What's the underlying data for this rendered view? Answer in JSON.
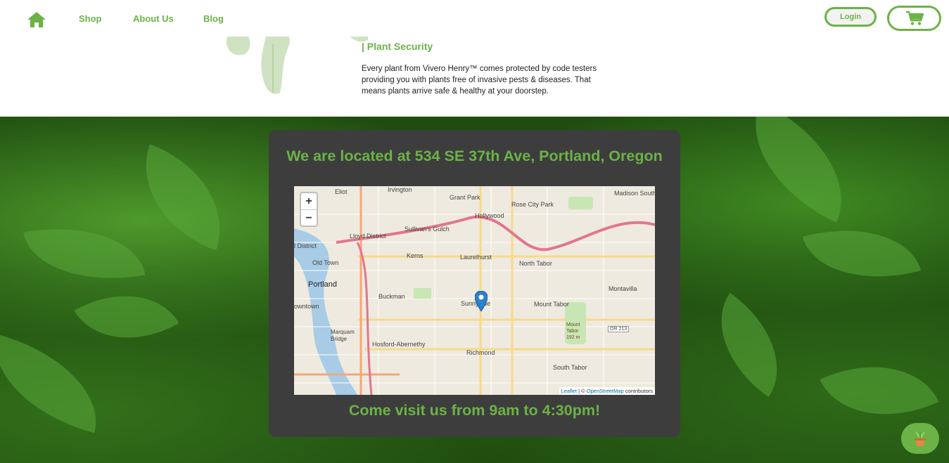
{
  "nav": {
    "links": [
      "Shop",
      "About Us",
      "Blog"
    ],
    "login_label": "Login"
  },
  "security": {
    "title": "| Plant Security",
    "body": "Every plant from Vivero Henry™ comes protected by code testers providing you with plants free of invasive pests & diseases. That means plants arrive safe & healthy at your doorstep."
  },
  "location": {
    "heading": "We are located at 534 SE 37th Ave, Portland, Oregon",
    "hours": "Come visit us from 9am to 4:30pm!"
  },
  "map": {
    "zoom_in": "+",
    "zoom_out": "−",
    "labels": [
      "Eliot",
      "Irvington",
      "Grant Park",
      "Rose City Park",
      "Madison South",
      "Hollywood",
      "Lloyd District",
      "Sullivan's Gulch",
      "Kerns",
      "Laurelhurst",
      "North Tabor",
      "l District",
      "Old Town",
      "Portland",
      "Buckman",
      "Sunnyside",
      "Mount Tabor",
      "Montavilla",
      "owntown",
      "Marquam Bridge",
      "Mount Tabor 192 m",
      "OR 213",
      "Hosford-Abernethy",
      "Richmond",
      "South Tabor"
    ],
    "attribution": {
      "leaflet": "Leaflet",
      "sep": " | © ",
      "osm": "OpenStreetMap",
      "suffix": " contributors"
    }
  },
  "colors": {
    "accent": "#6bb346",
    "card": "#3d3d3d"
  },
  "icons": {
    "home": "home-icon",
    "cart": "cart-icon",
    "plant": "potted-plant-icon",
    "marker": "map-marker-icon"
  }
}
